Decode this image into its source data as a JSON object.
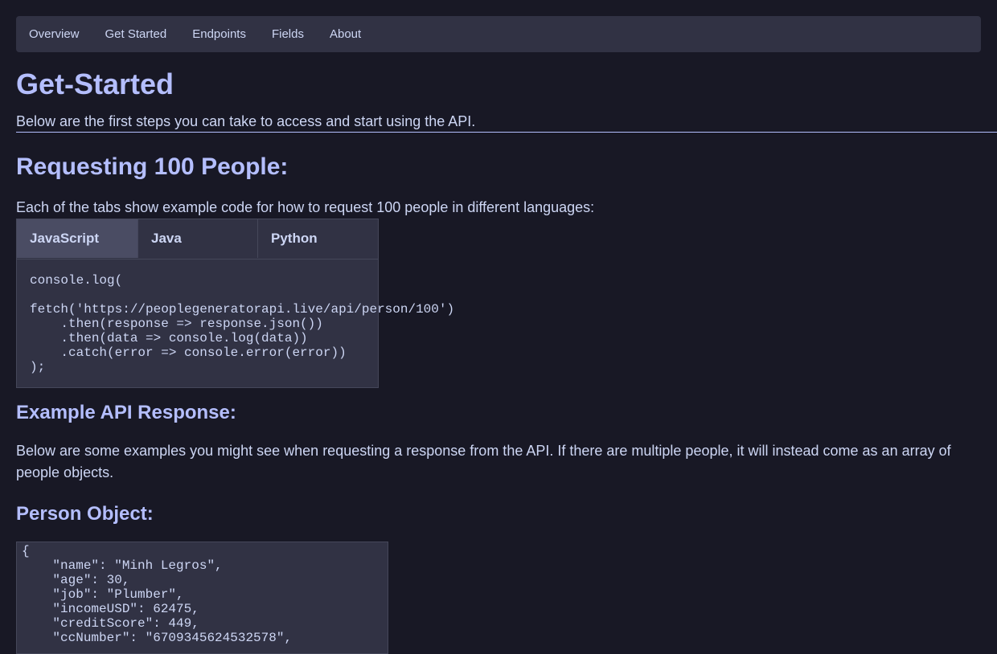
{
  "nav": {
    "items": [
      "Overview",
      "Get Started",
      "Endpoints",
      "Fields",
      "About"
    ]
  },
  "page": {
    "title": "Get-Started",
    "subtitle": "Below are the first steps you can take to access and start using the API."
  },
  "section_request": {
    "heading": "Requesting 100 People:",
    "description": "Each of the tabs show example code for how to request 100 people in different languages:",
    "tabs": [
      "JavaScript",
      "Java",
      "Python"
    ],
    "active_tab": "JavaScript",
    "code": "console.log(\n\nfetch('https://peoplegeneratorapi.live/api/person/100')\n    .then(response => response.json())\n    .then(data => console.log(data))\n    .catch(error => console.error(error))\n);"
  },
  "section_example": {
    "heading": "Example API Response:",
    "description": "Below are some examples you might see when requesting a response from the API. If there are multiple people, it will instead come as an array of people objects."
  },
  "section_person": {
    "heading": "Person Object:",
    "json": "{\n    \"name\": \"Minh Legros\",\n    \"age\": 30,\n    \"job\": \"Plumber\",\n    \"incomeUSD\": 62475,\n    \"creditScore\": 449,\n    \"ccNumber\": \"6709345624532578\","
  },
  "colors": {
    "background": "#181825",
    "panel": "#313244",
    "accent": "#b4befe",
    "text": "#cdd6f4",
    "active_tab": "#4a4c63"
  }
}
